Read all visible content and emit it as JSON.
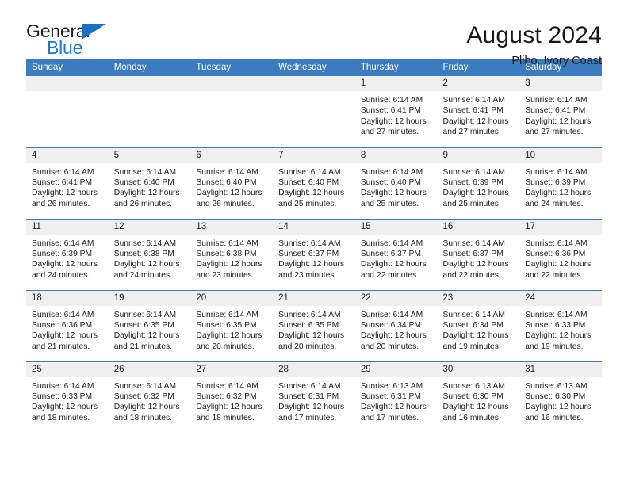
{
  "brand": {
    "name_top": "General",
    "name_bottom": "Blue",
    "triangle_color": "#1b6fc4",
    "blue_color": "#1b7ad0"
  },
  "header": {
    "title": "August 2024",
    "subtitle": "Plibo, Ivory Coast",
    "header_bg": "#3b7cc0",
    "daynum_bg": "#efefef"
  },
  "weekdays": [
    "Sunday",
    "Monday",
    "Tuesday",
    "Wednesday",
    "Thursday",
    "Friday",
    "Saturday"
  ],
  "labels": {
    "sunrise_prefix": "Sunrise:",
    "sunset_prefix": "Sunset:",
    "daylight_prefix": "Daylight:"
  },
  "weeks": [
    [
      {
        "day": "",
        "empty": true
      },
      {
        "day": "",
        "empty": true
      },
      {
        "day": "",
        "empty": true
      },
      {
        "day": "",
        "empty": true
      },
      {
        "day": "1",
        "sunrise": "Sunrise: 6:14 AM",
        "sunset": "Sunset: 6:41 PM",
        "daylight": "Daylight: 12 hours and 27 minutes."
      },
      {
        "day": "2",
        "sunrise": "Sunrise: 6:14 AM",
        "sunset": "Sunset: 6:41 PM",
        "daylight": "Daylight: 12 hours and 27 minutes."
      },
      {
        "day": "3",
        "sunrise": "Sunrise: 6:14 AM",
        "sunset": "Sunset: 6:41 PM",
        "daylight": "Daylight: 12 hours and 27 minutes."
      }
    ],
    [
      {
        "day": "4",
        "sunrise": "Sunrise: 6:14 AM",
        "sunset": "Sunset: 6:41 PM",
        "daylight": "Daylight: 12 hours and 26 minutes."
      },
      {
        "day": "5",
        "sunrise": "Sunrise: 6:14 AM",
        "sunset": "Sunset: 6:40 PM",
        "daylight": "Daylight: 12 hours and 26 minutes."
      },
      {
        "day": "6",
        "sunrise": "Sunrise: 6:14 AM",
        "sunset": "Sunset: 6:40 PM",
        "daylight": "Daylight: 12 hours and 26 minutes."
      },
      {
        "day": "7",
        "sunrise": "Sunrise: 6:14 AM",
        "sunset": "Sunset: 6:40 PM",
        "daylight": "Daylight: 12 hours and 25 minutes."
      },
      {
        "day": "8",
        "sunrise": "Sunrise: 6:14 AM",
        "sunset": "Sunset: 6:40 PM",
        "daylight": "Daylight: 12 hours and 25 minutes."
      },
      {
        "day": "9",
        "sunrise": "Sunrise: 6:14 AM",
        "sunset": "Sunset: 6:39 PM",
        "daylight": "Daylight: 12 hours and 25 minutes."
      },
      {
        "day": "10",
        "sunrise": "Sunrise: 6:14 AM",
        "sunset": "Sunset: 6:39 PM",
        "daylight": "Daylight: 12 hours and 24 minutes."
      }
    ],
    [
      {
        "day": "11",
        "sunrise": "Sunrise: 6:14 AM",
        "sunset": "Sunset: 6:39 PM",
        "daylight": "Daylight: 12 hours and 24 minutes."
      },
      {
        "day": "12",
        "sunrise": "Sunrise: 6:14 AM",
        "sunset": "Sunset: 6:38 PM",
        "daylight": "Daylight: 12 hours and 24 minutes."
      },
      {
        "day": "13",
        "sunrise": "Sunrise: 6:14 AM",
        "sunset": "Sunset: 6:38 PM",
        "daylight": "Daylight: 12 hours and 23 minutes."
      },
      {
        "day": "14",
        "sunrise": "Sunrise: 6:14 AM",
        "sunset": "Sunset: 6:37 PM",
        "daylight": "Daylight: 12 hours and 23 minutes."
      },
      {
        "day": "15",
        "sunrise": "Sunrise: 6:14 AM",
        "sunset": "Sunset: 6:37 PM",
        "daylight": "Daylight: 12 hours and 22 minutes."
      },
      {
        "day": "16",
        "sunrise": "Sunrise: 6:14 AM",
        "sunset": "Sunset: 6:37 PM",
        "daylight": "Daylight: 12 hours and 22 minutes."
      },
      {
        "day": "17",
        "sunrise": "Sunrise: 6:14 AM",
        "sunset": "Sunset: 6:36 PM",
        "daylight": "Daylight: 12 hours and 22 minutes."
      }
    ],
    [
      {
        "day": "18",
        "sunrise": "Sunrise: 6:14 AM",
        "sunset": "Sunset: 6:36 PM",
        "daylight": "Daylight: 12 hours and 21 minutes."
      },
      {
        "day": "19",
        "sunrise": "Sunrise: 6:14 AM",
        "sunset": "Sunset: 6:35 PM",
        "daylight": "Daylight: 12 hours and 21 minutes."
      },
      {
        "day": "20",
        "sunrise": "Sunrise: 6:14 AM",
        "sunset": "Sunset: 6:35 PM",
        "daylight": "Daylight: 12 hours and 20 minutes."
      },
      {
        "day": "21",
        "sunrise": "Sunrise: 6:14 AM",
        "sunset": "Sunset: 6:35 PM",
        "daylight": "Daylight: 12 hours and 20 minutes."
      },
      {
        "day": "22",
        "sunrise": "Sunrise: 6:14 AM",
        "sunset": "Sunset: 6:34 PM",
        "daylight": "Daylight: 12 hours and 20 minutes."
      },
      {
        "day": "23",
        "sunrise": "Sunrise: 6:14 AM",
        "sunset": "Sunset: 6:34 PM",
        "daylight": "Daylight: 12 hours and 19 minutes."
      },
      {
        "day": "24",
        "sunrise": "Sunrise: 6:14 AM",
        "sunset": "Sunset: 6:33 PM",
        "daylight": "Daylight: 12 hours and 19 minutes."
      }
    ],
    [
      {
        "day": "25",
        "sunrise": "Sunrise: 6:14 AM",
        "sunset": "Sunset: 6:33 PM",
        "daylight": "Daylight: 12 hours and 18 minutes."
      },
      {
        "day": "26",
        "sunrise": "Sunrise: 6:14 AM",
        "sunset": "Sunset: 6:32 PM",
        "daylight": "Daylight: 12 hours and 18 minutes."
      },
      {
        "day": "27",
        "sunrise": "Sunrise: 6:14 AM",
        "sunset": "Sunset: 6:32 PM",
        "daylight": "Daylight: 12 hours and 18 minutes."
      },
      {
        "day": "28",
        "sunrise": "Sunrise: 6:14 AM",
        "sunset": "Sunset: 6:31 PM",
        "daylight": "Daylight: 12 hours and 17 minutes."
      },
      {
        "day": "29",
        "sunrise": "Sunrise: 6:13 AM",
        "sunset": "Sunset: 6:31 PM",
        "daylight": "Daylight: 12 hours and 17 minutes."
      },
      {
        "day": "30",
        "sunrise": "Sunrise: 6:13 AM",
        "sunset": "Sunset: 6:30 PM",
        "daylight": "Daylight: 12 hours and 16 minutes."
      },
      {
        "day": "31",
        "sunrise": "Sunrise: 6:13 AM",
        "sunset": "Sunset: 6:30 PM",
        "daylight": "Daylight: 12 hours and 16 minutes."
      }
    ]
  ]
}
